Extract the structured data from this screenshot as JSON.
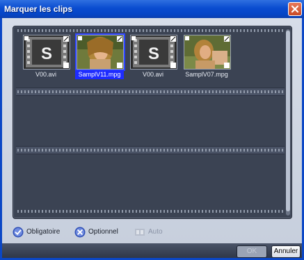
{
  "window": {
    "title": "Marquer les clips"
  },
  "clips": [
    {
      "name": "V00.avi",
      "thumb": "logo-s"
    },
    {
      "name": "SamplV11.mpg",
      "thumb": "photo-woman"
    },
    {
      "name": "V00.avi",
      "thumb": "logo-s"
    },
    {
      "name": "SamplV07.mpg",
      "thumb": "photo-woman"
    }
  ],
  "options": {
    "obligatoire": "Obligatoire",
    "optionnel": "Optionnel",
    "auto": "Auto"
  },
  "buttons": {
    "ok": "OK",
    "cancel": "Annuler"
  }
}
